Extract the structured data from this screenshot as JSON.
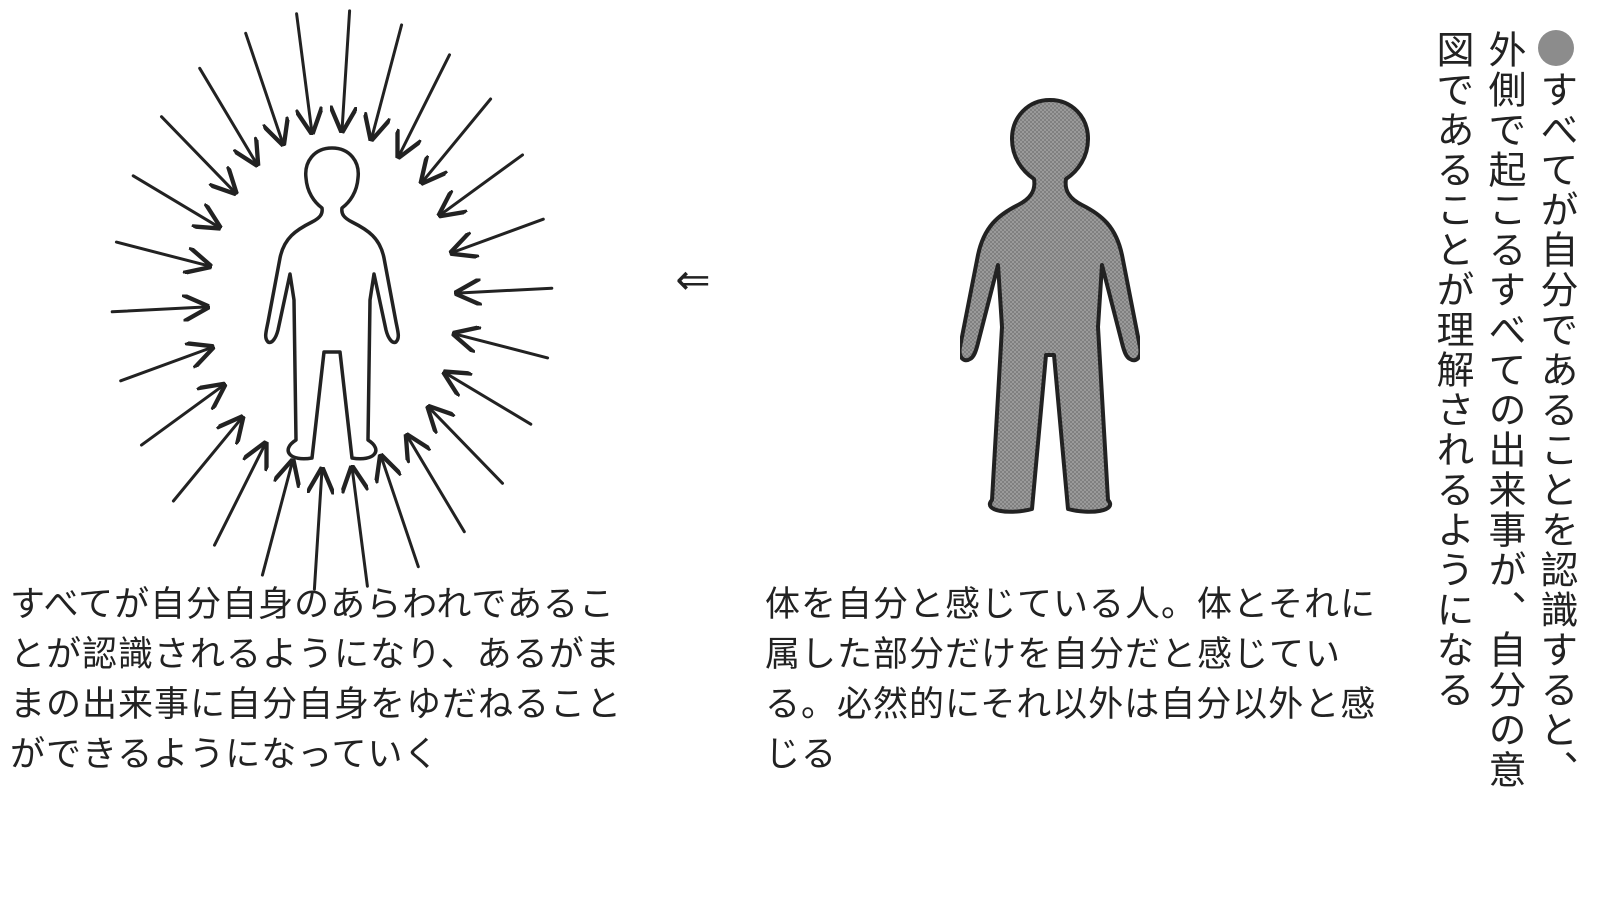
{
  "diagram": {
    "arrow_between": "⇐",
    "left_caption": "すべてが自分自身のあらわれであることが認識されるようになり、あるがままの出来事に自分自身をゆだねることができるようになっていく",
    "right_caption": "体を自分と感じている人。体とそれに属した部分だけを自分だと感じている。必然的にそれ以外は自分以外と感じる",
    "side_note": "すべてが自分であることを認識すると、外側で起こるすべての出来事が、自分の意図であることが理解されるようになる",
    "colors": {
      "bullet": "#8c8c8c",
      "figure_fill": "#8a8a8a",
      "ink": "#222222"
    }
  }
}
